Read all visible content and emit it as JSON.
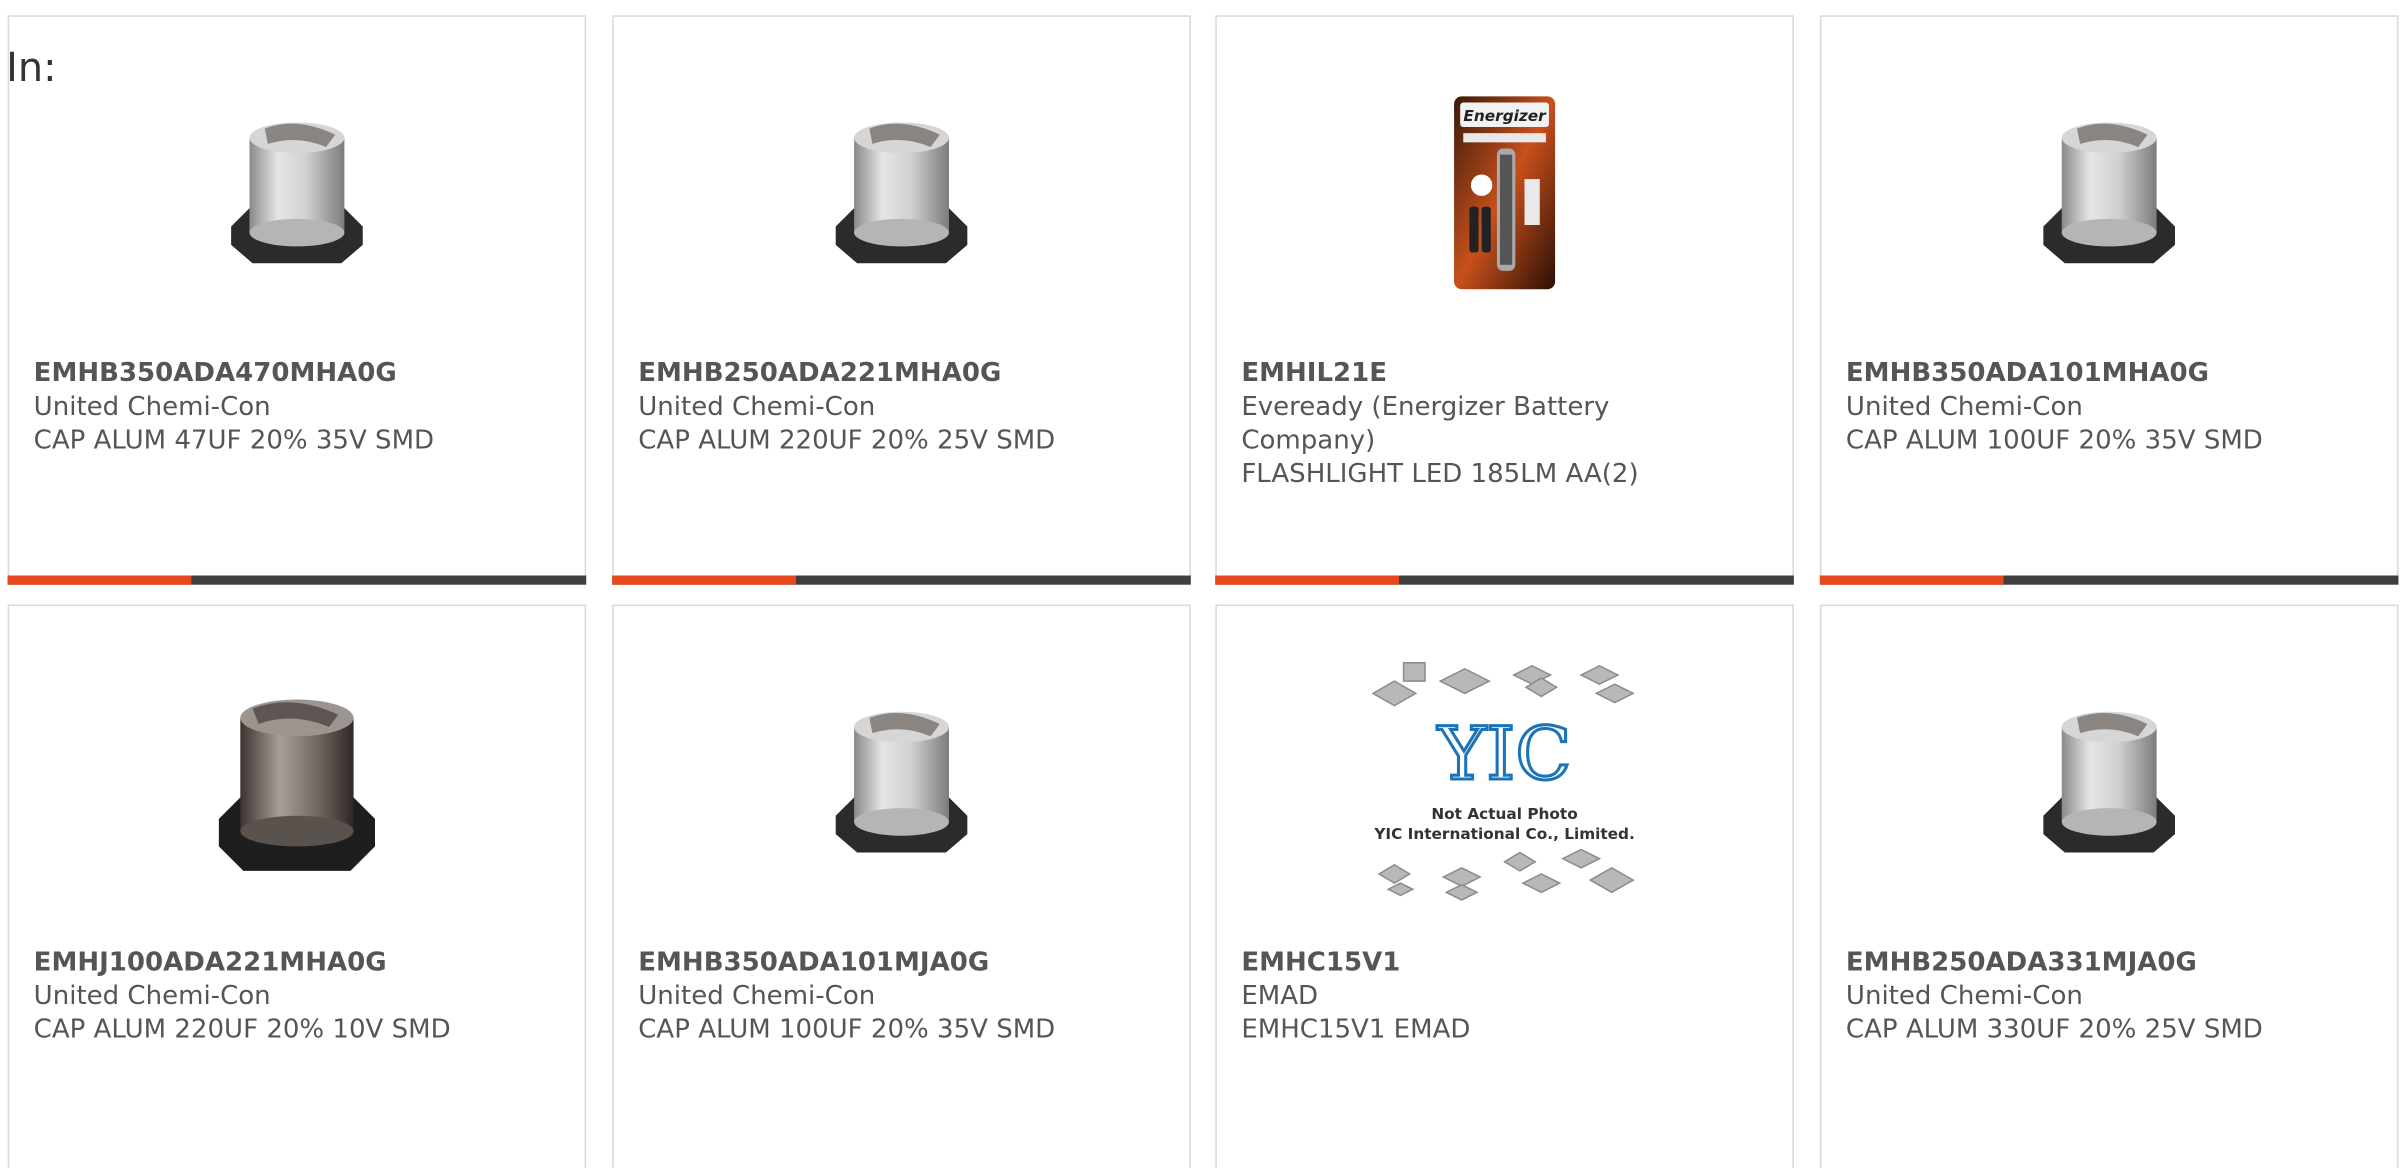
{
  "heading": "In:",
  "products": [
    {
      "part_number": "EMHB350ADA470MHA0G",
      "manufacturer": "United Chemi-Con",
      "description": "CAP ALUM 47UF 20% 35V SMD",
      "image": "capacitor-smd-icon"
    },
    {
      "part_number": "EMHB250ADA221MHA0G",
      "manufacturer": "United Chemi-Con",
      "description": "CAP ALUM 220UF 20% 25V SMD",
      "image": "capacitor-smd-icon"
    },
    {
      "part_number": "EMHIL21E",
      "manufacturer": "Eveready (Energizer Battery Company)",
      "description": "FLASHLIGHT LED 185LM AA(2)",
      "image": "flashlight-package-icon",
      "brand_text": "Energizer"
    },
    {
      "part_number": "EMHB350ADA101MHA0G",
      "manufacturer": "United Chemi-Con",
      "description": "CAP ALUM 100UF 20% 35V SMD",
      "image": "capacitor-smd-icon"
    },
    {
      "part_number": "EMHJ100ADA221MHA0G",
      "manufacturer": "United Chemi-Con",
      "description": "CAP ALUM 220UF 20% 10V SMD",
      "image": "capacitor-smd-dark-icon"
    },
    {
      "part_number": "EMHB350ADA101MJA0G",
      "manufacturer": "United Chemi-Con",
      "description": "CAP ALUM 100UF 20% 35V SMD",
      "image": "capacitor-smd-icon"
    },
    {
      "part_number": "EMHC15V1",
      "manufacturer": "EMAD",
      "description": "EMHC15V1 EMAD",
      "image": "placeholder-chips-icon",
      "placeholder_logo": "YIC",
      "placeholder_line1": "Not Actual Photo",
      "placeholder_line2": "YIC International Co., Limited."
    },
    {
      "part_number": "EMHB250ADA331MJA0G",
      "manufacturer": "United Chemi-Con",
      "description": "CAP ALUM 330UF 20% 25V SMD",
      "image": "capacitor-smd-icon"
    }
  ],
  "colors": {
    "accent": "#e8481d",
    "bar": "#3f3f3f",
    "text": "#555555",
    "border": "#d9d9d9"
  }
}
